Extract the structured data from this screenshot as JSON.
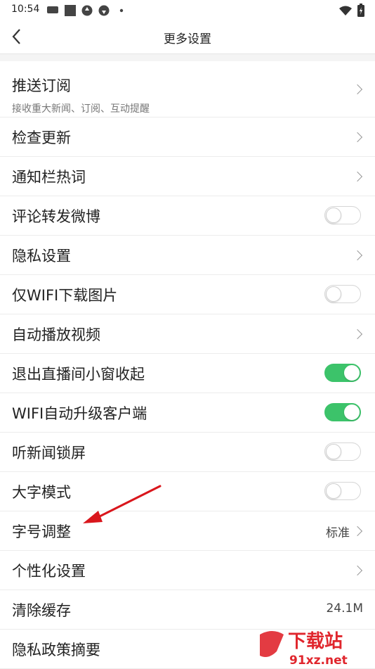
{
  "status_bar": {
    "time": "10:54"
  },
  "header": {
    "title": "更多设置"
  },
  "settings": [
    {
      "label": "推送订阅",
      "sublabel": "接收重大新闻、订阅、互动提醒",
      "control": "chevron"
    },
    {
      "label": "检查更新",
      "control": "chevron"
    },
    {
      "label": "通知栏热词",
      "control": "chevron"
    },
    {
      "label": "评论转发微博",
      "control": "toggle",
      "on": false
    },
    {
      "label": "隐私设置",
      "control": "chevron"
    },
    {
      "label": "仅WIFI下载图片",
      "control": "toggle",
      "on": false
    },
    {
      "label": "自动播放视频",
      "control": "chevron"
    },
    {
      "label": "退出直播间小窗收起",
      "control": "toggle",
      "on": true
    },
    {
      "label": "WIFI自动升级客户端",
      "control": "toggle",
      "on": true
    },
    {
      "label": "听新闻锁屏",
      "control": "toggle",
      "on": false
    },
    {
      "label": "大字模式",
      "control": "toggle",
      "on": false
    },
    {
      "label": "字号调整",
      "control": "value-chevron",
      "value": "标准"
    },
    {
      "label": "个性化设置",
      "control": "chevron"
    },
    {
      "label": "清除缓存",
      "control": "value",
      "value": "24.1M"
    },
    {
      "label": "隐私政策摘要",
      "control": "none"
    }
  ],
  "watermark": {
    "brand": "下载站",
    "site": "91xz.net"
  },
  "colors": {
    "toggle_on": "#3cc36a",
    "annotation_arrow": "#d9161c",
    "watermark": "#e0262d"
  },
  "icons": [
    "back-arrow-icon",
    "chevron-right-icon",
    "wifi-icon",
    "battery-icon"
  ]
}
